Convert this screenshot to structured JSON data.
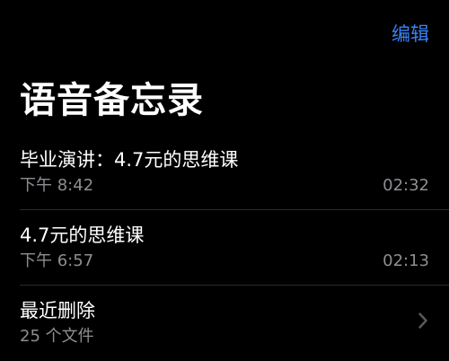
{
  "header": {
    "edit_label": "编辑",
    "accent_color": "#3a82f7"
  },
  "page": {
    "title": "语音备忘录"
  },
  "recordings": [
    {
      "title": "毕业演讲：4.7元的思维课",
      "time": "下午 8:42",
      "duration": "02:32"
    },
    {
      "title": "4.7元的思维课",
      "time": "下午 6:57",
      "duration": "02:13"
    }
  ],
  "recently_deleted": {
    "title": "最近删除",
    "count": "25 个文件",
    "icon": "chevron-right-icon"
  }
}
